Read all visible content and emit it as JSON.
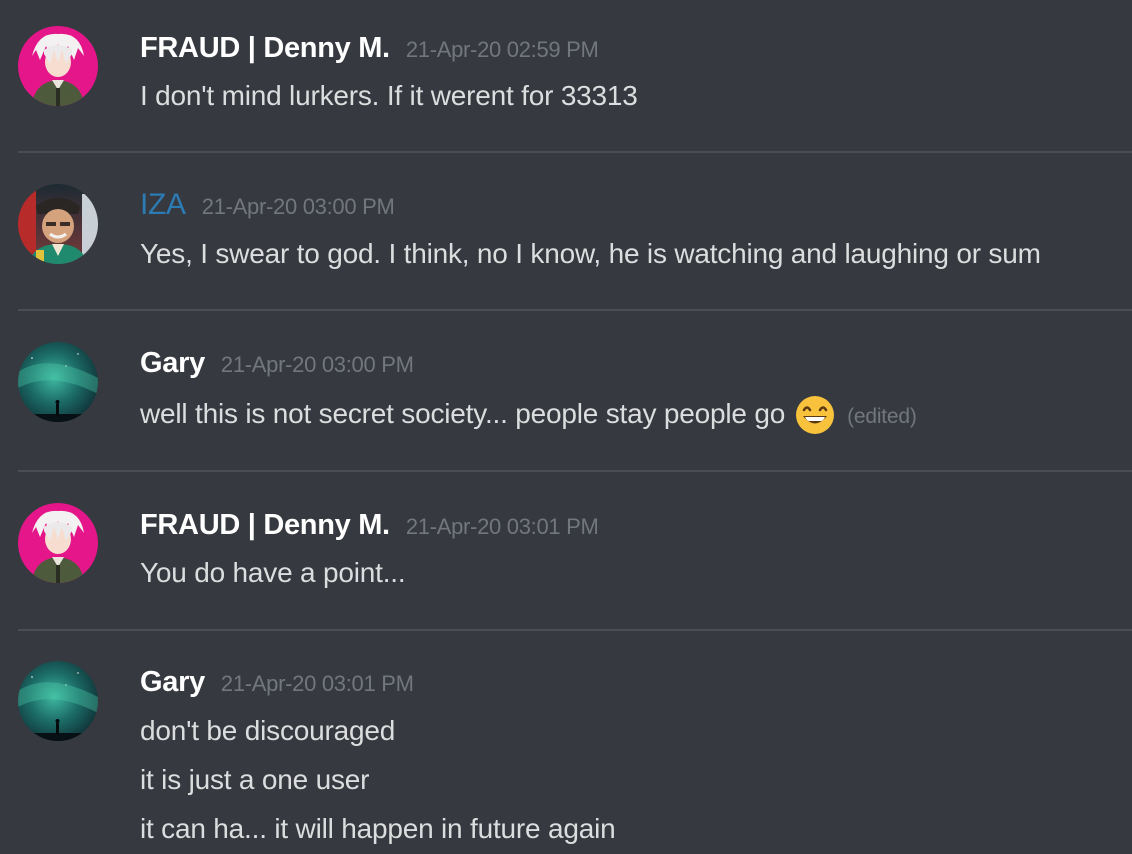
{
  "messages": [
    {
      "username": "FRAUD | Denny M.",
      "timestamp": "21-Apr-20 02:59 PM",
      "avatar": "anime-character-avatar-icon",
      "lines": [
        "I don't mind lurkers. If it werent for 33313"
      ]
    },
    {
      "username": "IZA",
      "timestamp": "21-Apr-20 03:00 PM",
      "avatar": "man-in-hat-avatar-icon",
      "username_color": "#2c7bb3",
      "lines": [
        "Yes, I swear to god. I think, no I know, he is watching and laughing or sum"
      ]
    },
    {
      "username": "Gary",
      "timestamp": "21-Apr-20 03:00 PM",
      "avatar": "aurora-sky-avatar-icon",
      "lines": [
        "well this is not secret society... people stay people go"
      ],
      "emoji": "grinning-face-emoji-icon",
      "edited": "(edited)"
    },
    {
      "username": "FRAUD | Denny M.",
      "timestamp": "21-Apr-20 03:01 PM",
      "avatar": "anime-character-avatar-icon",
      "lines": [
        "You do have a point..."
      ]
    },
    {
      "username": "Gary",
      "timestamp": "21-Apr-20 03:01 PM",
      "avatar": "aurora-sky-avatar-icon",
      "lines": [
        "don't be discouraged",
        "it is just a one user",
        "it can ha... it will happen in future again"
      ]
    }
  ],
  "colors": {
    "background": "#36393f",
    "username": "#ffffff",
    "timestamp": "#72767d",
    "message_text": "#dcddde",
    "divider": "#4a4d53"
  }
}
